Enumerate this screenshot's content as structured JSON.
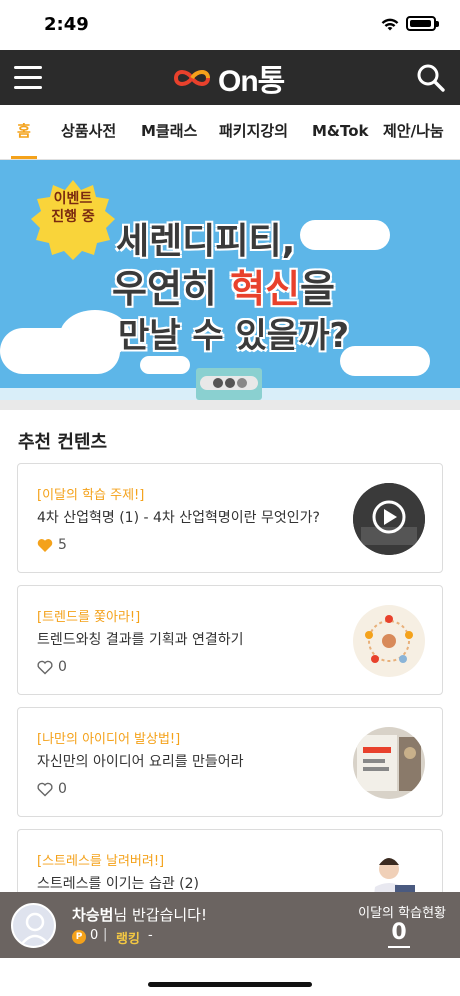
{
  "status_bar": {
    "time": "2:49"
  },
  "header": {
    "logo_text": "On통"
  },
  "tabs": [
    {
      "label": "홈",
      "active": true
    },
    {
      "label": "상품사전"
    },
    {
      "label": "M클래스"
    },
    {
      "label": "패키지강의"
    },
    {
      "label": "M&Tok"
    },
    {
      "label": "제안/나눔"
    }
  ],
  "banner": {
    "badge_line1": "이벤트",
    "badge_line2": "진행 중",
    "line1": "세렌디피티,",
    "line2_a": "우연히 ",
    "line2_b": "혁신",
    "line2_c": "을",
    "line3": "만날 수 있을까?"
  },
  "recommended": {
    "title": "추천 컨텐츠",
    "items": [
      {
        "category": "[이달의 학습 주제!]",
        "title": "4차 산업혁명 (1) - 4차 산업혁명이란 무엇인가?",
        "likes": "5",
        "liked": true
      },
      {
        "category": "[트렌드를 쫓아라!]",
        "title": "트렌드와칭 결과를 기획과 연결하기",
        "likes": "0",
        "liked": false
      },
      {
        "category": "[나만의 아이디어 발상법!]",
        "title": "자신만의 아이디어 요리를 만들어라",
        "likes": "0",
        "liked": false
      },
      {
        "category": "[스트레스를 날려버려!]",
        "title": "스트레스를 이기는 습관 (2)",
        "likes": "",
        "liked": false
      }
    ]
  },
  "user_bar": {
    "name": "차승범",
    "greeting_suffix": "님 반갑습니다!",
    "coin_symbol": "P",
    "points": "0",
    "separator": "|",
    "rank_label": "랭킹",
    "rank_value": "-",
    "stats_label": "이달의 학습현황",
    "stats_value": "0"
  },
  "colors": {
    "accent": "#f4a21b",
    "header_bg": "#2b2b2b",
    "banner_bg": "#5db6e8",
    "user_bar_bg": "#6b6461"
  }
}
